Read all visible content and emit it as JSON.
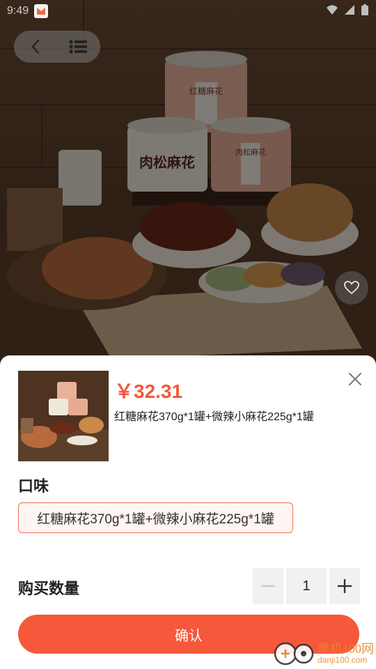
{
  "status_bar": {
    "time": "9:49"
  },
  "nav": {
    "back_icon": "chevron-left-icon",
    "menu_icon": "list-icon"
  },
  "hero": {
    "tin_labels": [
      "红糖麻花",
      "肉松麻花",
      "肉松麻花"
    ],
    "favorite_icon": "heart-icon"
  },
  "sheet": {
    "price": "￥32.31",
    "selected_sku": "红糖麻花370g*1罐+微辣小麻花225g*1罐",
    "flavor_title": "口味",
    "flavor_options": [
      "红糖麻花370g*1罐+微辣小麻花225g*1罐"
    ],
    "quantity_label": "购买数量",
    "quantity": "1",
    "confirm_label": "确认"
  },
  "watermark": {
    "name": "单机100网",
    "url": "danji100.com"
  },
  "colors": {
    "accent": "#f5583a",
    "chip_border": "#f06a55",
    "watermark": "#e4892c"
  }
}
